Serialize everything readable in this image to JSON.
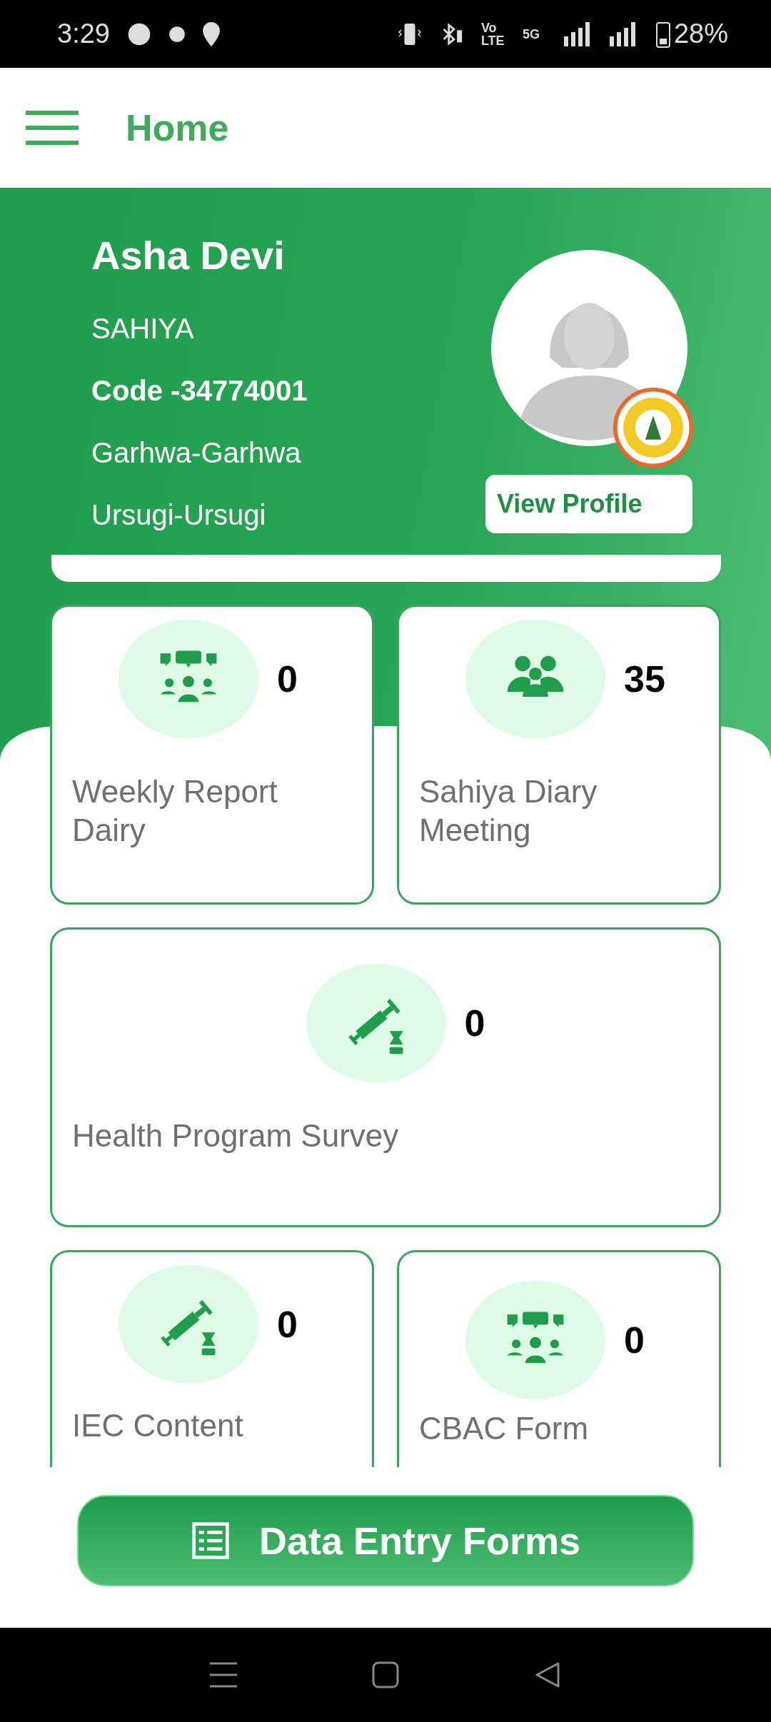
{
  "status_bar": {
    "time": "3:29",
    "volte": "Vo LTE",
    "network": "5G",
    "battery": "28%"
  },
  "app_bar": {
    "title": "Home"
  },
  "profile": {
    "name": "Asha Devi",
    "role": "SAHIYA",
    "code": "Code -34774001",
    "district": "Garhwa-Garhwa",
    "block": "Ursugi-Ursugi",
    "button": "View Profile"
  },
  "tiles": [
    {
      "kind": "meeting",
      "count": "0",
      "label": "Weekly Report Dairy",
      "wide": false
    },
    {
      "kind": "group",
      "count": "35",
      "label": "Sahiya Diary Meeting",
      "wide": false
    },
    {
      "kind": "vaccine",
      "count": "0",
      "label": "Health Program Survey",
      "wide": true
    },
    {
      "kind": "vaccine",
      "count": "0",
      "label": "IEC Content",
      "wide": false
    },
    {
      "kind": "meeting",
      "count": "0",
      "label": "CBAC Form",
      "wide": false
    }
  ],
  "action_button": {
    "label": "Data Entry Forms"
  }
}
